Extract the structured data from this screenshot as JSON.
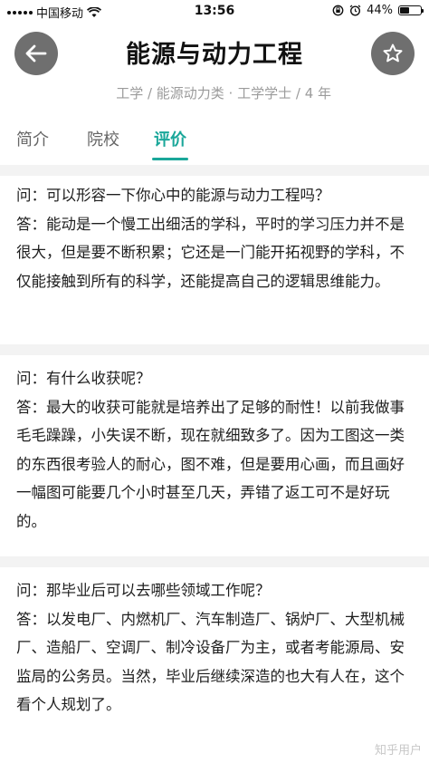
{
  "status": {
    "carrier": "中国移动",
    "time": "13:56",
    "battery_level": "44%",
    "battery_fraction": 0.44
  },
  "header": {
    "title": "能源与动力工程",
    "meta": "工学 / 能源动力类 · 工学学士 / 4 年",
    "back_icon": "arrow-left-icon",
    "favorite_icon": "star-outline-icon"
  },
  "tabs": [
    {
      "label": "简介",
      "active": false
    },
    {
      "label": "院校",
      "active": false
    },
    {
      "label": "评价",
      "active": true
    }
  ],
  "qa": [
    {
      "question": "问：可以形容一下你心中的能源与动力工程吗？",
      "answer": "答：能动是一个慢工出细活的学科，平时的学习压力并不是很大，但是要不断积累；它还是一门能开拓视野的学科，不仅能接触到所有的科学，还能提高自己的逻辑思维能力。"
    },
    {
      "question": "问：有什么收获呢？",
      "answer": "答：最大的收获可能就是培养出了足够的耐性！以前我做事毛毛躁躁，小失误不断，现在就细致多了。因为工图这一类的东西很考验人的耐心，图不难，但是要用心画，而且画好一幅图可能要几个小时甚至几天，弄错了返工可不是好玩的。"
    },
    {
      "question": "问：那毕业后可以去哪些领域工作呢？",
      "answer": "答：以发电厂、内燃机厂、汽车制造厂、锅炉厂、大型机械厂、造船厂、空调厂、制冷设备厂为主，或者考能源局、安监局的公务员。当然，毕业后继续深造的也大有人在，这个看个人规划了。"
    }
  ],
  "watermark": "知乎用户",
  "colors": {
    "accent": "#1aa79a",
    "button_bg": "#6f6f6f",
    "divider": "#f3f3f3"
  }
}
